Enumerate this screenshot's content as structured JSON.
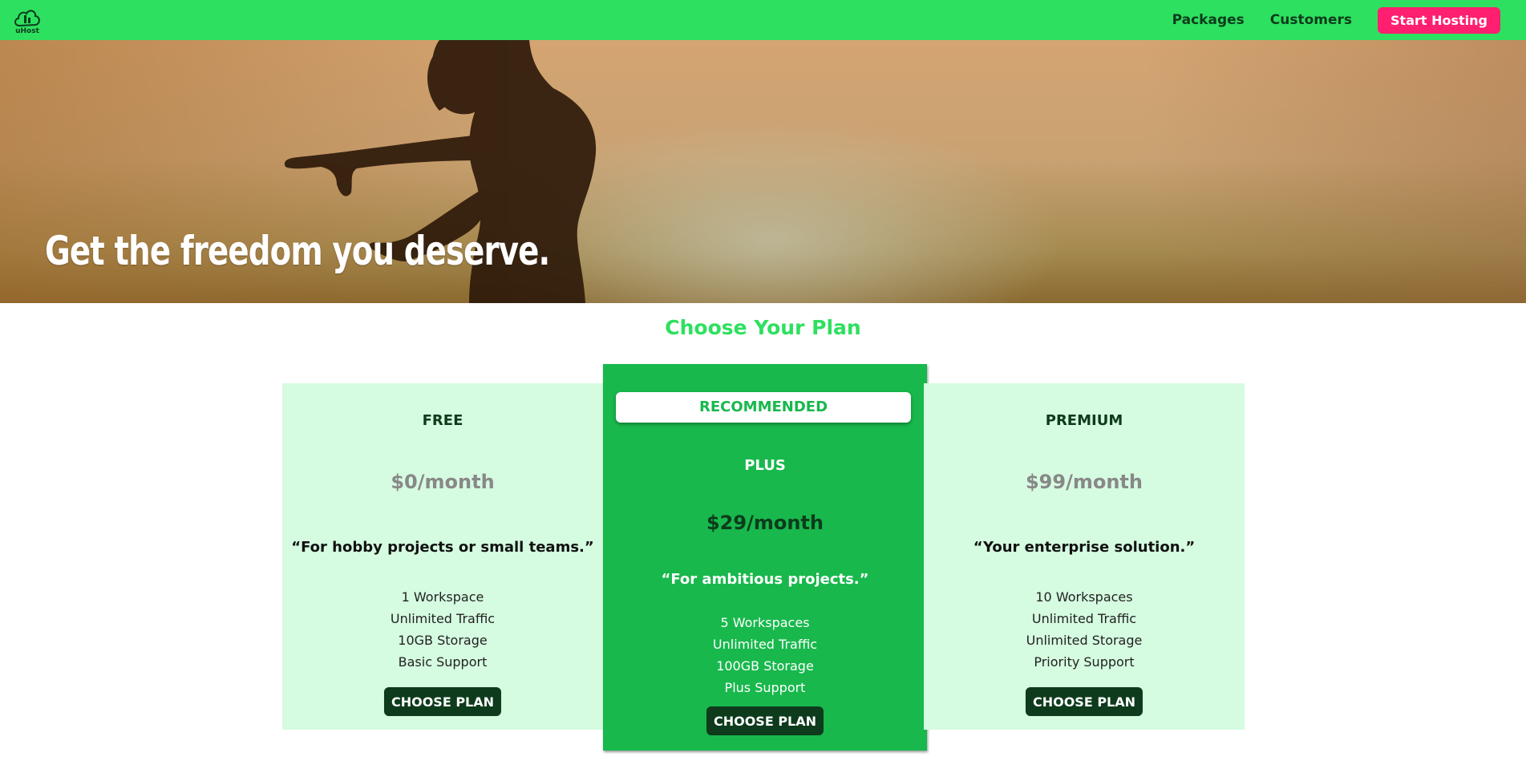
{
  "header": {
    "logo_icon": "cloud-logo-icon",
    "logo_text": "uHost",
    "nav": [
      {
        "label": "Packages"
      },
      {
        "label": "Customers"
      }
    ],
    "cta_label": "Start Hosting"
  },
  "hero": {
    "title": "Get the freedom you deserve."
  },
  "pricing": {
    "title": "Choose Your Plan",
    "plans": [
      {
        "name": "FREE",
        "price": "$0/month",
        "tagline": "“For hobby projects or small teams.”",
        "features": [
          "1 Workspace",
          "Unlimited Traffic",
          "10GB Storage",
          "Basic Support"
        ],
        "button": "CHOOSE PLAN"
      },
      {
        "badge": "RECOMMENDED",
        "name": "PLUS",
        "price": "$29/month",
        "tagline": "“For ambitious projects.”",
        "features": [
          "5 Workspaces",
          "Unlimited Traffic",
          "100GB Storage",
          "Plus Support"
        ],
        "button": "CHOOSE PLAN"
      },
      {
        "name": "PREMIUM",
        "price": "$99/month",
        "tagline": "“Your enterprise solution.”",
        "features": [
          "10 Workspaces",
          "Unlimited Traffic",
          "Unlimited Storage",
          "Priority Support"
        ],
        "button": "CHOOSE PLAN"
      }
    ]
  },
  "colors": {
    "brand_green": "#2ee05f",
    "featured_green": "#18b84c",
    "dark_green": "#0d3b1c",
    "light_green": "#d5fbe0",
    "cta_pink": "#ff1f70"
  }
}
